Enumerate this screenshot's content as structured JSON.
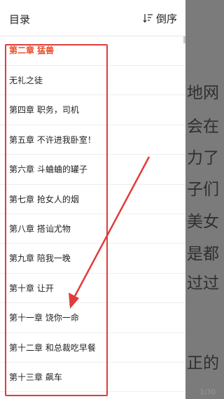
{
  "drawer": {
    "title": "目录",
    "sort_label": "倒序",
    "sort_icon": "sort-descending-icon"
  },
  "chapters": [
    {
      "label": "第二章 猛兽",
      "current": true
    },
    {
      "label": "无礼之徒",
      "current": false
    },
    {
      "label": "第四章 职务，司机",
      "current": false
    },
    {
      "label": "第五章 不许进我卧室！",
      "current": false
    },
    {
      "label": "第六章 斗蛐蛐的罐子",
      "current": false
    },
    {
      "label": "第七章 抢女人的烟",
      "current": false
    },
    {
      "label": "第八章 搭讪尤物",
      "current": false
    },
    {
      "label": "第九章 陪我一晚",
      "current": false
    },
    {
      "label": "第十章 让开",
      "current": false
    },
    {
      "label": "第十一章 饶你一命",
      "current": false
    },
    {
      "label": "第十二章 和总裁吃早餐",
      "current": false
    },
    {
      "label": "第十三章 飙车",
      "current": false
    }
  ],
  "reader": {
    "lines": [
      "地网",
      "会在",
      "力了",
      "子们",
      "美女",
      "是都",
      "过过",
      "",
      "正的"
    ],
    "page_indicator": "1/30"
  },
  "colors": {
    "current_chapter": "#e8502c",
    "annotation": "#e23b3b",
    "overlay": "#7b7b7b"
  }
}
